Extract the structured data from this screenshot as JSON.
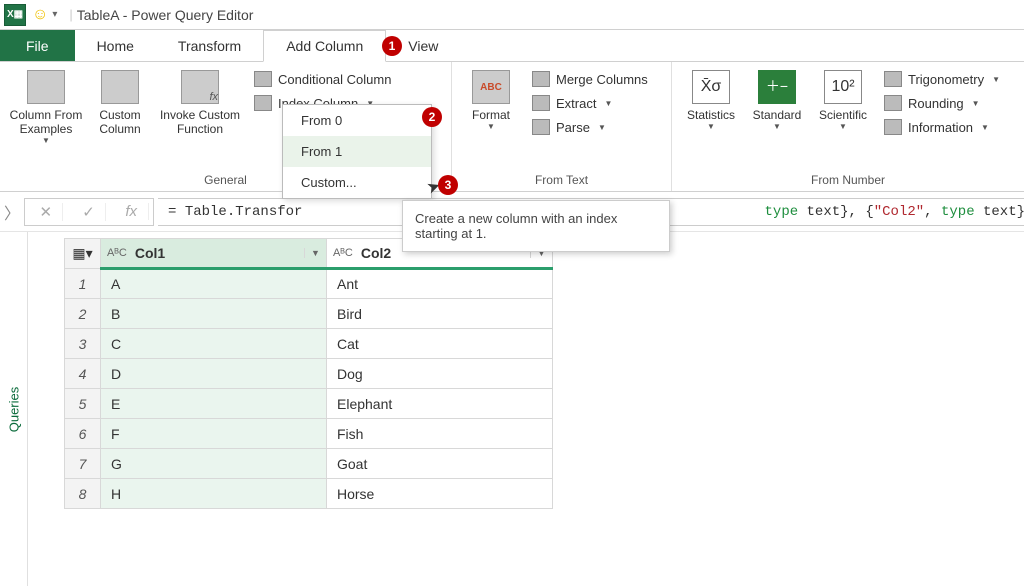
{
  "title": "TableA - Power Query Editor",
  "tabs": {
    "file": "File",
    "home": "Home",
    "transform": "Transform",
    "add": "Add Column",
    "view": "View"
  },
  "ribbon": {
    "general": {
      "label": "General",
      "col_from_examples": "Column From\nExamples",
      "custom_column": "Custom\nColumn",
      "invoke_custom": "Invoke Custom\nFunction",
      "conditional": "Conditional Column",
      "index": "Index Column"
    },
    "index_menu": {
      "from0": "From 0",
      "from1": "From 1",
      "custom": "Custom..."
    },
    "from_text": {
      "label": "From Text",
      "format": "Format",
      "merge": "Merge Columns",
      "extract": "Extract",
      "parse": "Parse"
    },
    "from_number": {
      "label": "From Number",
      "statistics": "Statistics",
      "standard": "Standard",
      "scientific": "Scientific",
      "trig": "Trigonometry",
      "rounding": "Rounding",
      "info": "Information"
    }
  },
  "tooltip": "Create a new column with an index starting at 1.",
  "formula": {
    "prefix": "= Table.Transfor",
    "mid1": "type",
    "mid2": " text}, {",
    "str": "\"Col2\"",
    "mid3": ", ",
    "mid4": "type",
    "mid5": " text}})"
  },
  "side_panel": "Queries",
  "columns": {
    "c1": "Col1",
    "c2": "Col2",
    "type": "AᴮC"
  },
  "rows": [
    {
      "n": "1",
      "c1": "A",
      "c2": "Ant"
    },
    {
      "n": "2",
      "c1": "B",
      "c2": "Bird"
    },
    {
      "n": "3",
      "c1": "C",
      "c2": "Cat"
    },
    {
      "n": "4",
      "c1": "D",
      "c2": "Dog"
    },
    {
      "n": "5",
      "c1": "E",
      "c2": "Elephant"
    },
    {
      "n": "6",
      "c1": "F",
      "c2": "Fish"
    },
    {
      "n": "7",
      "c1": "G",
      "c2": "Goat"
    },
    {
      "n": "8",
      "c1": "H",
      "c2": "Horse"
    }
  ],
  "badges": {
    "b1": "1",
    "b2": "2",
    "b3": "3"
  }
}
